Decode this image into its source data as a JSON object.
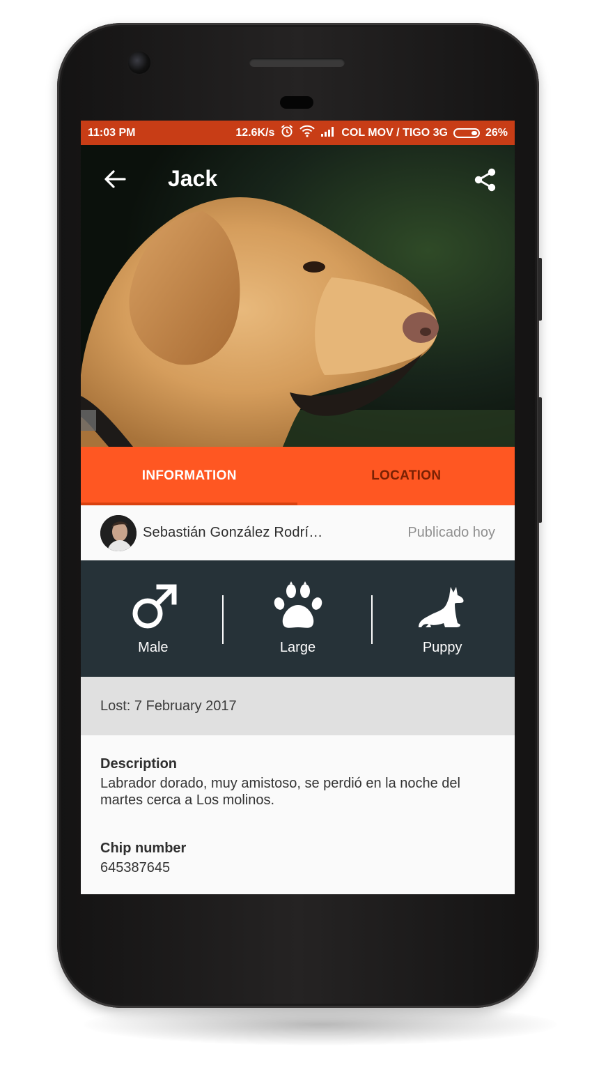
{
  "status_bar": {
    "time": "11:03 PM",
    "net_speed": "12.6K/s",
    "carrier": "COL MOV / TIGO 3G",
    "battery": "26%",
    "icons": [
      "alarm-icon",
      "wifi-icon",
      "signal-icon",
      "battery-icon"
    ]
  },
  "app_bar": {
    "title": "Jack",
    "back_icon": "arrow-back-icon",
    "share_icon": "share-icon"
  },
  "hero": {
    "subject": "dog-photo"
  },
  "tabs": [
    {
      "label": "INFORMATION",
      "selected": true
    },
    {
      "label": "LOCATION",
      "selected": false
    }
  ],
  "author": {
    "name": "Sebastián González Rodrí…",
    "published": "Publicado hoy"
  },
  "attributes": [
    {
      "label": "Male",
      "icon": "male-symbol-icon"
    },
    {
      "label": "Large",
      "icon": "paw-icon"
    },
    {
      "label": "Puppy",
      "icon": "dog-sitting-icon"
    }
  ],
  "lost": {
    "text": "Lost: 7 February 2017"
  },
  "details": {
    "description_label": "Description",
    "description_value": "Labrador dorado, muy amistoso, se perdió en la noche del martes cerca a Los molinos.",
    "chip_label": "Chip number",
    "chip_value": "645387645"
  },
  "colors": {
    "status_bar": "#c83d16",
    "accent": "#ff5722",
    "attributes_panel": "#263238",
    "lost_bar": "#e0e0e0"
  }
}
